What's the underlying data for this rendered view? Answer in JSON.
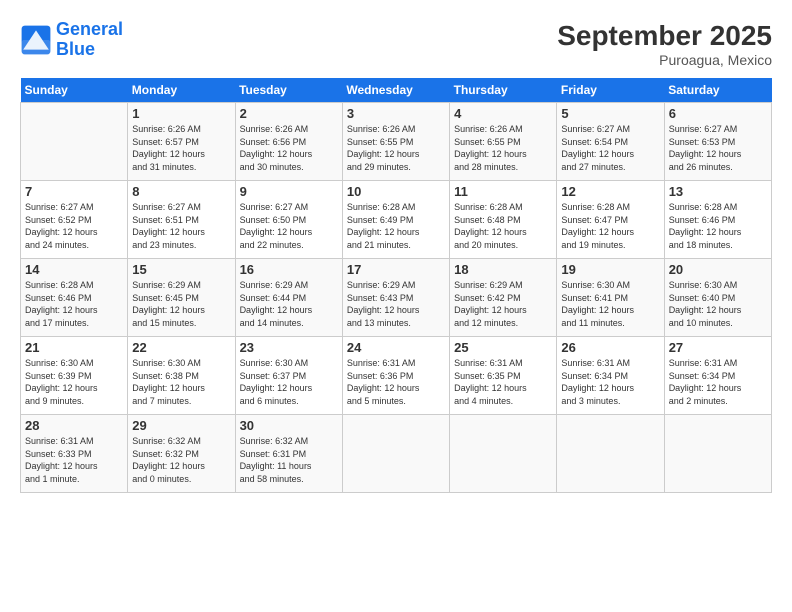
{
  "header": {
    "logo_line1": "General",
    "logo_line2": "Blue",
    "month": "September 2025",
    "location": "Puroagua, Mexico"
  },
  "days_of_week": [
    "Sunday",
    "Monday",
    "Tuesday",
    "Wednesday",
    "Thursday",
    "Friday",
    "Saturday"
  ],
  "weeks": [
    [
      {
        "day": "",
        "info": ""
      },
      {
        "day": "1",
        "info": "Sunrise: 6:26 AM\nSunset: 6:57 PM\nDaylight: 12 hours\nand 31 minutes."
      },
      {
        "day": "2",
        "info": "Sunrise: 6:26 AM\nSunset: 6:56 PM\nDaylight: 12 hours\nand 30 minutes."
      },
      {
        "day": "3",
        "info": "Sunrise: 6:26 AM\nSunset: 6:55 PM\nDaylight: 12 hours\nand 29 minutes."
      },
      {
        "day": "4",
        "info": "Sunrise: 6:26 AM\nSunset: 6:55 PM\nDaylight: 12 hours\nand 28 minutes."
      },
      {
        "day": "5",
        "info": "Sunrise: 6:27 AM\nSunset: 6:54 PM\nDaylight: 12 hours\nand 27 minutes."
      },
      {
        "day": "6",
        "info": "Sunrise: 6:27 AM\nSunset: 6:53 PM\nDaylight: 12 hours\nand 26 minutes."
      }
    ],
    [
      {
        "day": "7",
        "info": "Sunrise: 6:27 AM\nSunset: 6:52 PM\nDaylight: 12 hours\nand 24 minutes."
      },
      {
        "day": "8",
        "info": "Sunrise: 6:27 AM\nSunset: 6:51 PM\nDaylight: 12 hours\nand 23 minutes."
      },
      {
        "day": "9",
        "info": "Sunrise: 6:27 AM\nSunset: 6:50 PM\nDaylight: 12 hours\nand 22 minutes."
      },
      {
        "day": "10",
        "info": "Sunrise: 6:28 AM\nSunset: 6:49 PM\nDaylight: 12 hours\nand 21 minutes."
      },
      {
        "day": "11",
        "info": "Sunrise: 6:28 AM\nSunset: 6:48 PM\nDaylight: 12 hours\nand 20 minutes."
      },
      {
        "day": "12",
        "info": "Sunrise: 6:28 AM\nSunset: 6:47 PM\nDaylight: 12 hours\nand 19 minutes."
      },
      {
        "day": "13",
        "info": "Sunrise: 6:28 AM\nSunset: 6:46 PM\nDaylight: 12 hours\nand 18 minutes."
      }
    ],
    [
      {
        "day": "14",
        "info": "Sunrise: 6:28 AM\nSunset: 6:46 PM\nDaylight: 12 hours\nand 17 minutes."
      },
      {
        "day": "15",
        "info": "Sunrise: 6:29 AM\nSunset: 6:45 PM\nDaylight: 12 hours\nand 15 minutes."
      },
      {
        "day": "16",
        "info": "Sunrise: 6:29 AM\nSunset: 6:44 PM\nDaylight: 12 hours\nand 14 minutes."
      },
      {
        "day": "17",
        "info": "Sunrise: 6:29 AM\nSunset: 6:43 PM\nDaylight: 12 hours\nand 13 minutes."
      },
      {
        "day": "18",
        "info": "Sunrise: 6:29 AM\nSunset: 6:42 PM\nDaylight: 12 hours\nand 12 minutes."
      },
      {
        "day": "19",
        "info": "Sunrise: 6:30 AM\nSunset: 6:41 PM\nDaylight: 12 hours\nand 11 minutes."
      },
      {
        "day": "20",
        "info": "Sunrise: 6:30 AM\nSunset: 6:40 PM\nDaylight: 12 hours\nand 10 minutes."
      }
    ],
    [
      {
        "day": "21",
        "info": "Sunrise: 6:30 AM\nSunset: 6:39 PM\nDaylight: 12 hours\nand 9 minutes."
      },
      {
        "day": "22",
        "info": "Sunrise: 6:30 AM\nSunset: 6:38 PM\nDaylight: 12 hours\nand 7 minutes."
      },
      {
        "day": "23",
        "info": "Sunrise: 6:30 AM\nSunset: 6:37 PM\nDaylight: 12 hours\nand 6 minutes."
      },
      {
        "day": "24",
        "info": "Sunrise: 6:31 AM\nSunset: 6:36 PM\nDaylight: 12 hours\nand 5 minutes."
      },
      {
        "day": "25",
        "info": "Sunrise: 6:31 AM\nSunset: 6:35 PM\nDaylight: 12 hours\nand 4 minutes."
      },
      {
        "day": "26",
        "info": "Sunrise: 6:31 AM\nSunset: 6:34 PM\nDaylight: 12 hours\nand 3 minutes."
      },
      {
        "day": "27",
        "info": "Sunrise: 6:31 AM\nSunset: 6:34 PM\nDaylight: 12 hours\nand 2 minutes."
      }
    ],
    [
      {
        "day": "28",
        "info": "Sunrise: 6:31 AM\nSunset: 6:33 PM\nDaylight: 12 hours\nand 1 minute."
      },
      {
        "day": "29",
        "info": "Sunrise: 6:32 AM\nSunset: 6:32 PM\nDaylight: 12 hours\nand 0 minutes."
      },
      {
        "day": "30",
        "info": "Sunrise: 6:32 AM\nSunset: 6:31 PM\nDaylight: 11 hours\nand 58 minutes."
      },
      {
        "day": "",
        "info": ""
      },
      {
        "day": "",
        "info": ""
      },
      {
        "day": "",
        "info": ""
      },
      {
        "day": "",
        "info": ""
      }
    ]
  ]
}
